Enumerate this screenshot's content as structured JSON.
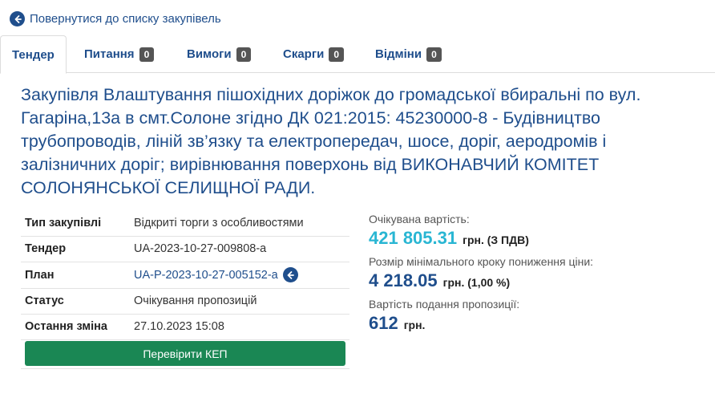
{
  "nav": {
    "back_label": "Повернутися до списку закупівель"
  },
  "tabs": [
    {
      "label": "Тендер",
      "count": ""
    },
    {
      "label": "Питання",
      "count": "0"
    },
    {
      "label": "Вимоги",
      "count": "0"
    },
    {
      "label": "Скарги",
      "count": "0"
    },
    {
      "label": "Відміни",
      "count": "0"
    }
  ],
  "title": "Закупівля Влаштування пішохідних доріжок до громадської вбиральні по вул. Гагаріна,13а в смт.Солоне згідно ДК 021:2015: 45230000-8 - Будівництво трубопроводів, ліній зв’язку та електропередач, шосе, доріг, аеродромів і залізничних доріг; вирівнювання поверхонь від ВИКОНАВЧИЙ КОМІТЕТ СОЛОНЯНСЬКОЇ СЕЛИЩНОЇ РАДИ.",
  "info": {
    "rows": [
      {
        "key": "Тип закупівлі",
        "value": "Відкриті торги з особливостями"
      },
      {
        "key": "Тендер",
        "value": "UA-2023-10-27-009808-a"
      },
      {
        "key": "План",
        "value": "UA-P-2023-10-27-005152-a"
      },
      {
        "key": "Статус",
        "value": "Очікування пропозицій"
      },
      {
        "key": "Остання зміна",
        "value": "27.10.2023 15:08"
      }
    ],
    "kep_button": "Перевірити КЕП"
  },
  "summary": {
    "expected_label": "Очікувана вартість:",
    "expected_amount": "421 805.31",
    "expected_unit": "грн. (З ПДВ)",
    "step_label": "Розмір мінімального кроку пониження ціни:",
    "step_amount": "4 218.05",
    "step_unit": "грн. (1,00 %)",
    "fee_label": "Вартість подання пропозиції:",
    "fee_amount": "612",
    "fee_unit": "грн."
  },
  "colors": {
    "primary": "#1f4e8c",
    "accent_amount": "#29b6d3",
    "button": "#1a8754",
    "badge": "#555555"
  },
  "icons": {
    "back": "arrow-left-circle-icon",
    "plan_link": "arrow-left-circle-icon"
  }
}
